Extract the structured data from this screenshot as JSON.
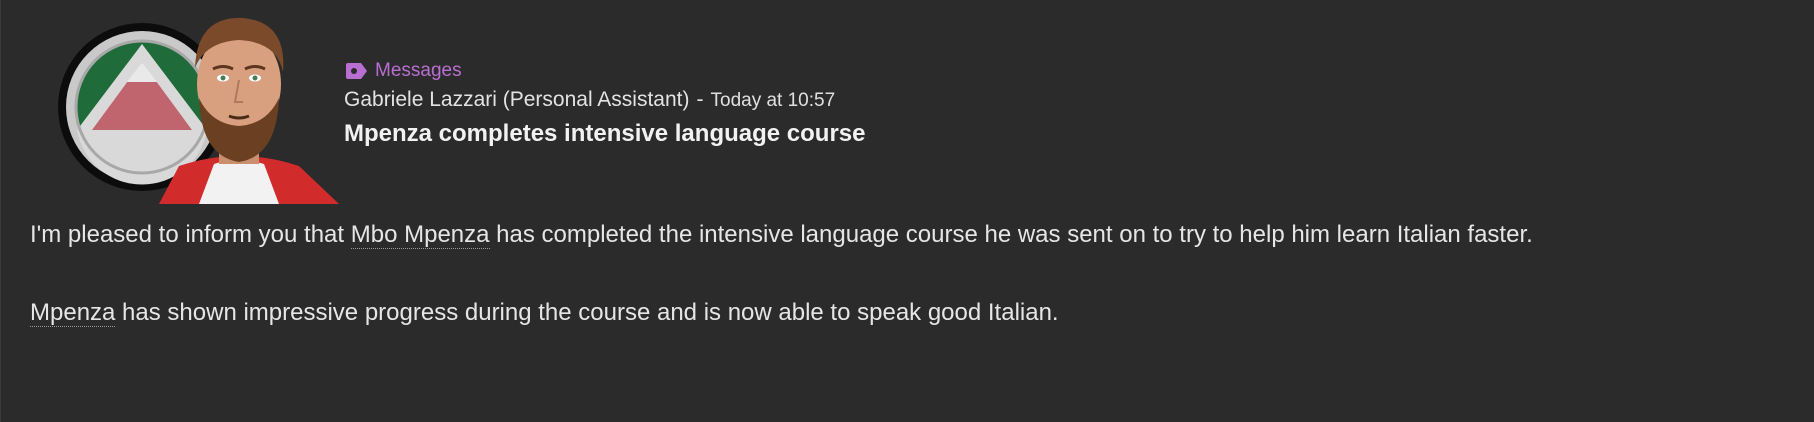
{
  "message": {
    "category_label": "Messages",
    "category_color": "#b86fd1",
    "category_icon": "tag-icon",
    "sender": "Gabriele Lazzari (Personal Assistant)",
    "separator": "-",
    "time": "Today at 10:57",
    "subject": "Mpenza completes intensive language course",
    "paragraph1": {
      "before": "I'm pleased to inform you that ",
      "player": "Mbo Mpenza",
      "after": " has completed the intensive language course he was sent on to try to help him learn Italian faster."
    },
    "paragraph2": {
      "player": "Mpenza",
      "after": " has shown impressive progress during the course and is now able to speak good Italian."
    }
  },
  "colors": {
    "background": "#2b2b2b",
    "badge_green": "#1f6b3a",
    "badge_red": "#c0646e",
    "badge_silver": "#c9c9c9"
  }
}
